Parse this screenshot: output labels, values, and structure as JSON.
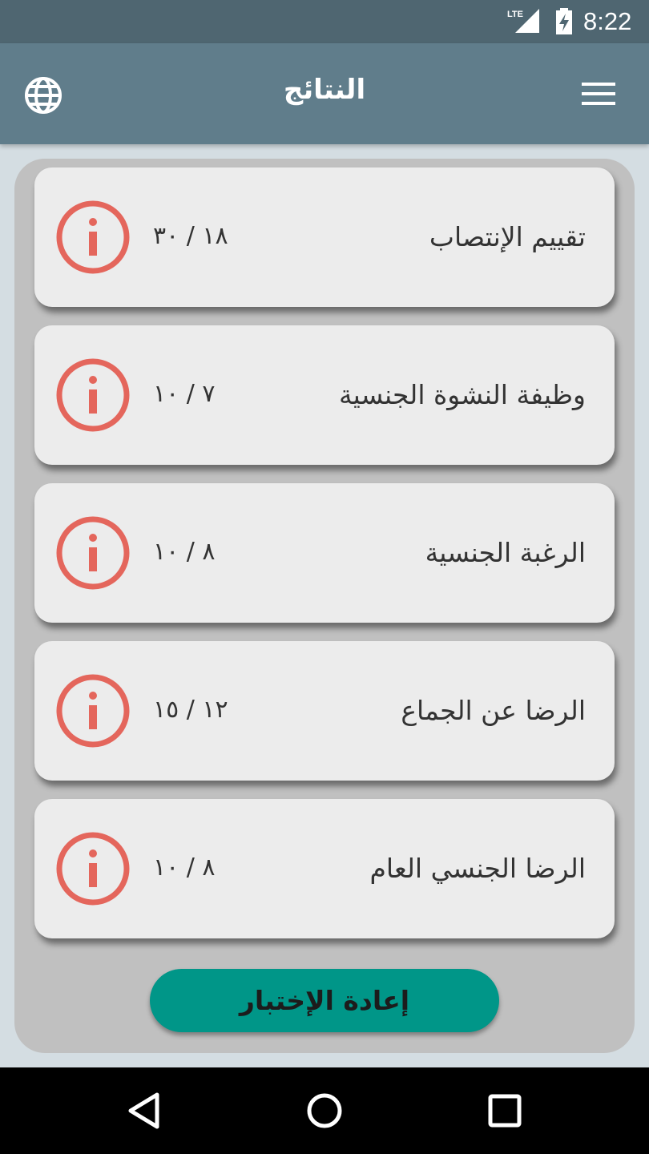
{
  "status_bar": {
    "network_label": "LTE",
    "time": "8:22"
  },
  "app_bar": {
    "title": "النتائج",
    "left_icon": "globe-icon",
    "right_icon": "hamburger-menu-icon"
  },
  "results": [
    {
      "label": "تقييم الإنتصاب",
      "score": "١٨ / ٣٠"
    },
    {
      "label": "وظيفة النشوة الجنسية",
      "score": "٧ / ١٠"
    },
    {
      "label": "الرغبة الجنسية",
      "score": "٨ / ١٠"
    },
    {
      "label": "الرضا عن الجماع",
      "score": "١٢ / ١٥"
    },
    {
      "label": "الرضا الجنسي العام",
      "score": "٨ / ١٠"
    }
  ],
  "retest_button": {
    "label": "إعادة الإختبار"
  },
  "colors": {
    "status_bar": "#4f6671",
    "app_bar": "#607d8b",
    "info_icon": "#e4665c",
    "button": "#009688",
    "background": "#d4dde2",
    "panel": "#c0c0c0",
    "card": "#ececec"
  },
  "nav_bar": {
    "back_icon": "back-triangle-icon",
    "home_icon": "home-circle-icon",
    "recents_icon": "recents-square-icon"
  }
}
